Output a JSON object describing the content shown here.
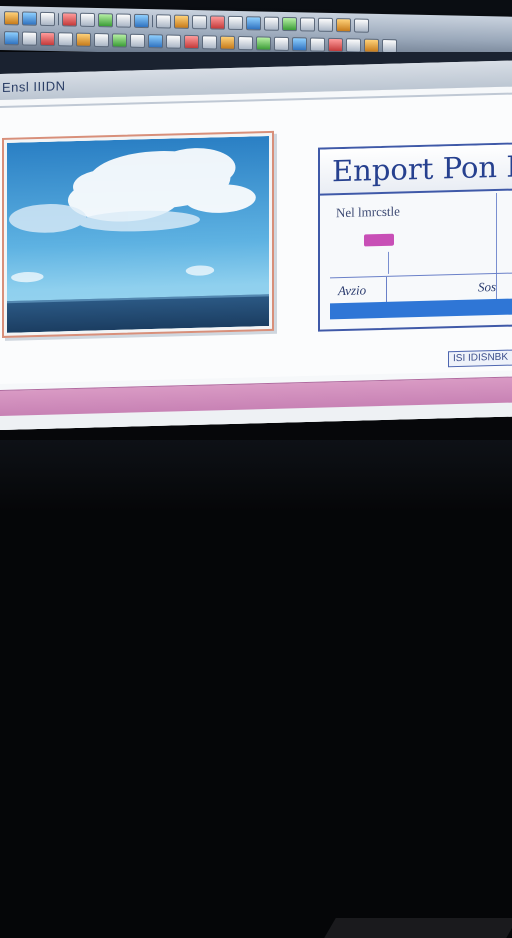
{
  "window": {
    "title": "Ensl IIIDN"
  },
  "form": {
    "title": "Enport Pon Po",
    "field_label": "Nel lmrcstle",
    "col_a": "Avzio",
    "col_b": "Sos",
    "status": "ISI IDISNBK"
  },
  "colors": {
    "form_border": "#3f59a8",
    "accent_badge": "#c84fb6",
    "selection": "#2f76d6",
    "pink_bar": "#d99ac4"
  },
  "icons": [
    "toolbar-button-icons",
    "sky-image"
  ]
}
